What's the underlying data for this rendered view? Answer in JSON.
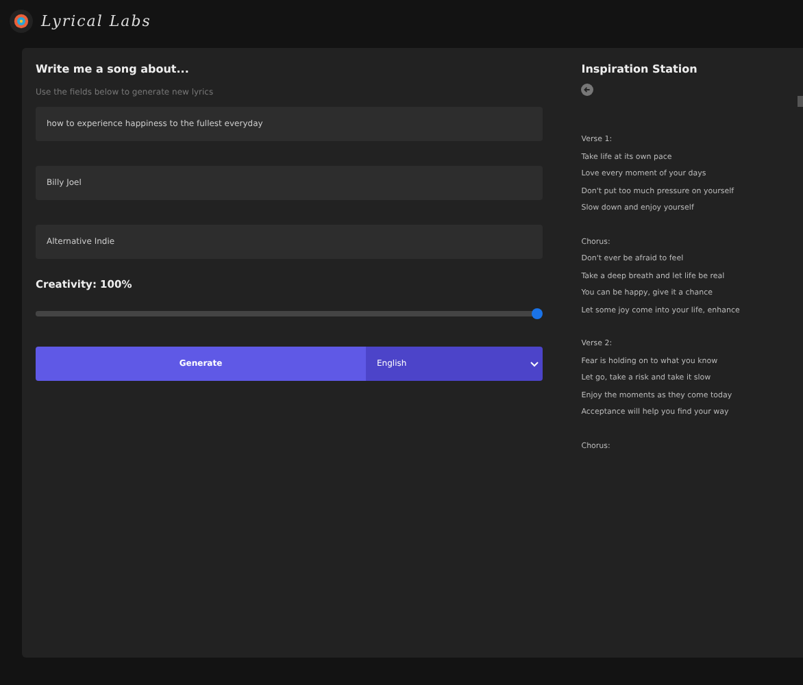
{
  "header": {
    "logo_text": "Lyrical Labs"
  },
  "form": {
    "title": "Write me a song about...",
    "subtitle": "Use the fields below to generate new lyrics",
    "fields": [
      {
        "value": "how to experience happiness to the fullest everyday"
      },
      {
        "value": "Billy Joel"
      },
      {
        "value": "Alternative Indie"
      }
    ],
    "creativity": {
      "label": "Creativity: 100%",
      "level": 1
    },
    "generate_button": "Generate",
    "language": "English"
  },
  "inspiration": {
    "title": "Inspiration Station",
    "sections": [
      {
        "heading": "Verse 1:",
        "lines": [
          "Take life at its own pace",
          "Love every moment of your days",
          "Don't put too much pressure on yourself",
          "Slow down and enjoy yourself"
        ]
      },
      {
        "heading": "Chorus:",
        "lines": [
          "Don't ever be afraid to feel",
          "Take a deep breath and let life be real",
          "You can be happy, give it a chance",
          "Let some joy come into your life, enhance"
        ]
      },
      {
        "heading": "Verse 2:",
        "lines": [
          "Fear is holding on to what you know",
          "Let go, take a risk and take it slow",
          "Enjoy the moments as they come today",
          "Acceptance will help you find your way"
        ]
      },
      {
        "heading": "Chorus:"
      }
    ]
  }
}
